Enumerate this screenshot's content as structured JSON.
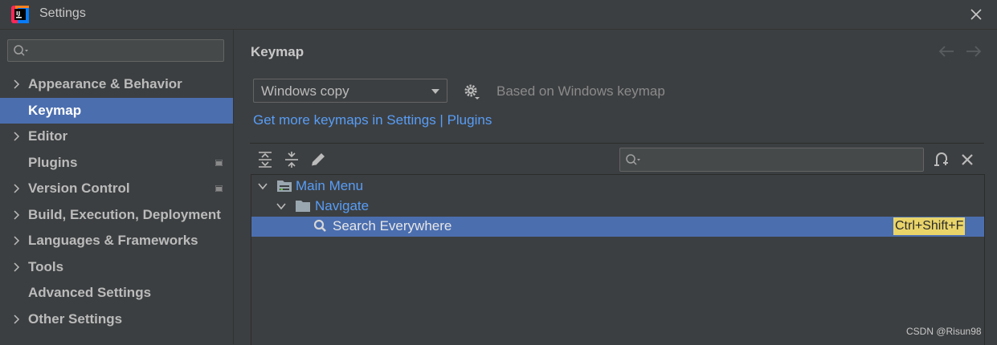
{
  "window": {
    "title": "Settings"
  },
  "sidebar": {
    "search_placeholder": "",
    "items": [
      {
        "label": "Appearance & Behavior",
        "expandable": true
      },
      {
        "label": "Keymap",
        "selected": true
      },
      {
        "label": "Editor",
        "expandable": true
      },
      {
        "label": "Plugins",
        "badge": true
      },
      {
        "label": "Version Control",
        "expandable": true,
        "badge": true
      },
      {
        "label": "Build, Execution, Deployment",
        "expandable": true
      },
      {
        "label": "Languages & Frameworks",
        "expandable": true
      },
      {
        "label": "Tools",
        "expandable": true
      },
      {
        "label": "Advanced Settings"
      },
      {
        "label": "Other Settings",
        "expandable": true
      }
    ]
  },
  "main": {
    "title": "Keymap",
    "keymap_select": {
      "value": "Windows copy"
    },
    "based_on": "Based on Windows keymap",
    "get_more_link": "Get more keymaps in Settings | Plugins",
    "search_placeholder": ""
  },
  "tree": {
    "rows": [
      {
        "label": "Main Menu",
        "icon": "menu-folder-icon",
        "expanded": true
      },
      {
        "label": "Navigate",
        "icon": "folder-icon",
        "expanded": true
      },
      {
        "label": "Search Everywhere",
        "icon": "search-icon",
        "selected": true,
        "shortcut": "Ctrl+Shift+F"
      }
    ]
  },
  "watermark": "CSDN @Risun98",
  "colors": {
    "background": "#3c3f41",
    "selection": "#4b6eaf",
    "link": "#589df6",
    "shortcut_highlight": "#e9d46a"
  }
}
